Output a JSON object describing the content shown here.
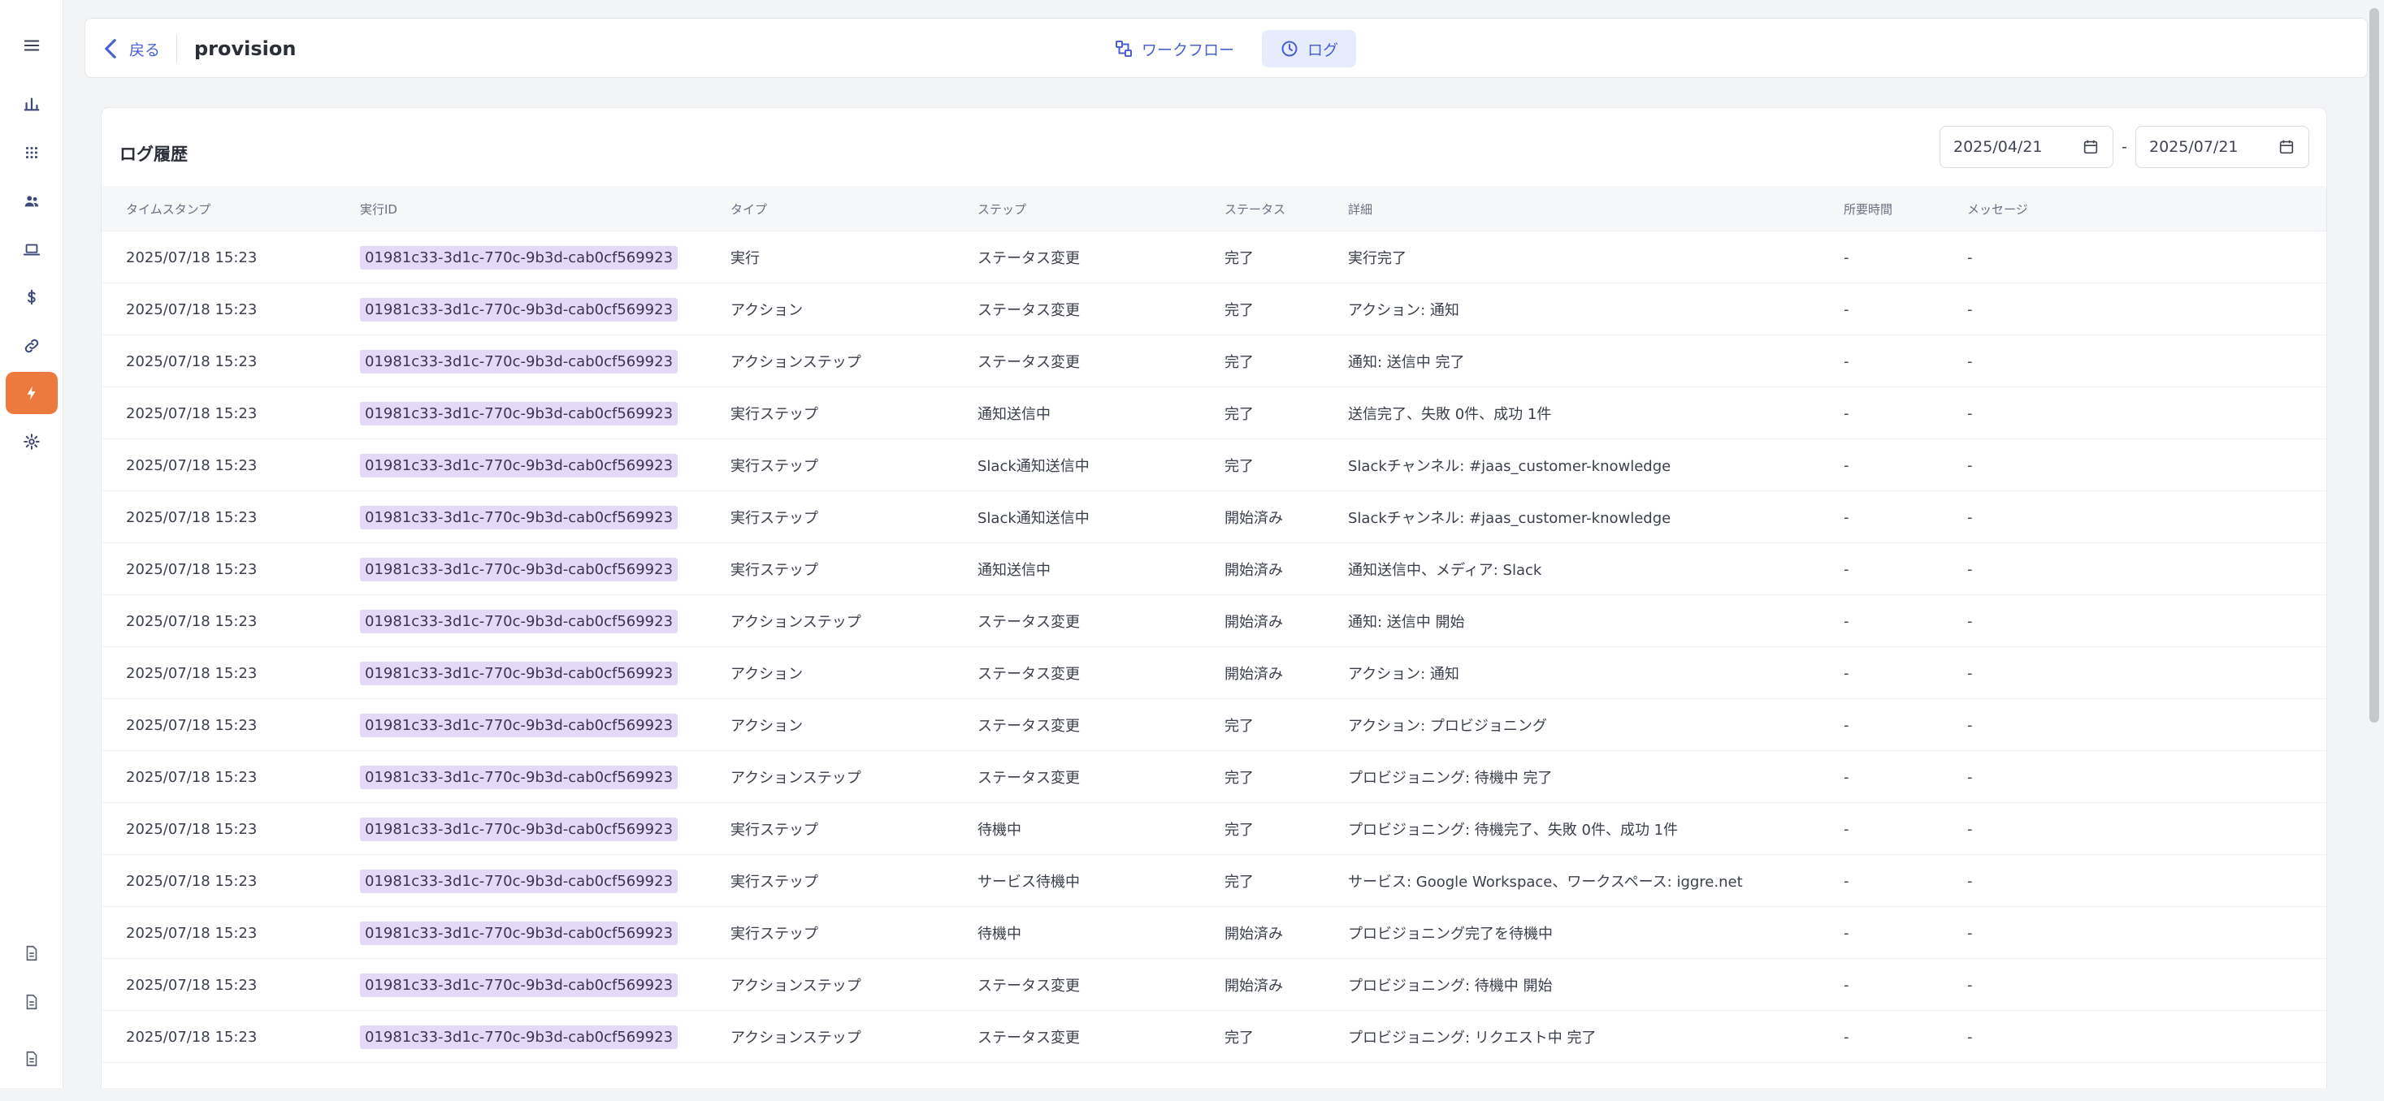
{
  "header": {
    "back_label": "戻る",
    "title": "provision",
    "tabs": [
      {
        "label": "ワークフロー",
        "icon": "workflow-icon"
      },
      {
        "label": "ログ",
        "icon": "clock-icon"
      }
    ]
  },
  "log": {
    "title": "ログ履歴",
    "date_from": "2025/04/21",
    "date_separator": "-",
    "date_to": "2025/07/21",
    "columns": [
      "タイムスタンプ",
      "実行ID",
      "タイプ",
      "ステップ",
      "ステータス",
      "詳細",
      "所要時間",
      "メッセージ"
    ],
    "rows": [
      {
        "ts": "2025/07/18 15:23",
        "id": "01981c33-3d1c-770c-9b3d-cab0cf569923",
        "type": "実行",
        "step": "ステータス変更",
        "status": "完了",
        "detail": "実行完了",
        "dur": "-",
        "msg": "-"
      },
      {
        "ts": "2025/07/18 15:23",
        "id": "01981c33-3d1c-770c-9b3d-cab0cf569923",
        "type": "アクション",
        "step": "ステータス変更",
        "status": "完了",
        "detail": "アクション: 通知",
        "dur": "-",
        "msg": "-"
      },
      {
        "ts": "2025/07/18 15:23",
        "id": "01981c33-3d1c-770c-9b3d-cab0cf569923",
        "type": "アクションステップ",
        "step": "ステータス変更",
        "status": "完了",
        "detail": "通知: 送信中 完了",
        "dur": "-",
        "msg": "-"
      },
      {
        "ts": "2025/07/18 15:23",
        "id": "01981c33-3d1c-770c-9b3d-cab0cf569923",
        "type": "実行ステップ",
        "step": "通知送信中",
        "status": "完了",
        "detail": "送信完了、失敗 0件、成功 1件",
        "dur": "-",
        "msg": "-"
      },
      {
        "ts": "2025/07/18 15:23",
        "id": "01981c33-3d1c-770c-9b3d-cab0cf569923",
        "type": "実行ステップ",
        "step": "Slack通知送信中",
        "status": "完了",
        "detail": "Slackチャンネル: #jaas_customer-knowledge",
        "dur": "-",
        "msg": "-"
      },
      {
        "ts": "2025/07/18 15:23",
        "id": "01981c33-3d1c-770c-9b3d-cab0cf569923",
        "type": "実行ステップ",
        "step": "Slack通知送信中",
        "status": "開始済み",
        "detail": "Slackチャンネル: #jaas_customer-knowledge",
        "dur": "-",
        "msg": "-"
      },
      {
        "ts": "2025/07/18 15:23",
        "id": "01981c33-3d1c-770c-9b3d-cab0cf569923",
        "type": "実行ステップ",
        "step": "通知送信中",
        "status": "開始済み",
        "detail": "通知送信中、メディア: Slack",
        "dur": "-",
        "msg": "-"
      },
      {
        "ts": "2025/07/18 15:23",
        "id": "01981c33-3d1c-770c-9b3d-cab0cf569923",
        "type": "アクションステップ",
        "step": "ステータス変更",
        "status": "開始済み",
        "detail": "通知: 送信中 開始",
        "dur": "-",
        "msg": "-"
      },
      {
        "ts": "2025/07/18 15:23",
        "id": "01981c33-3d1c-770c-9b3d-cab0cf569923",
        "type": "アクション",
        "step": "ステータス変更",
        "status": "開始済み",
        "detail": "アクション: 通知",
        "dur": "-",
        "msg": "-"
      },
      {
        "ts": "2025/07/18 15:23",
        "id": "01981c33-3d1c-770c-9b3d-cab0cf569923",
        "type": "アクション",
        "step": "ステータス変更",
        "status": "完了",
        "detail": "アクション: プロビジョニング",
        "dur": "-",
        "msg": "-"
      },
      {
        "ts": "2025/07/18 15:23",
        "id": "01981c33-3d1c-770c-9b3d-cab0cf569923",
        "type": "アクションステップ",
        "step": "ステータス変更",
        "status": "完了",
        "detail": "プロビジョニング: 待機中 完了",
        "dur": "-",
        "msg": "-"
      },
      {
        "ts": "2025/07/18 15:23",
        "id": "01981c33-3d1c-770c-9b3d-cab0cf569923",
        "type": "実行ステップ",
        "step": "待機中",
        "status": "完了",
        "detail": "プロビジョニング: 待機完了、失敗 0件、成功 1件",
        "dur": "-",
        "msg": "-"
      },
      {
        "ts": "2025/07/18 15:23",
        "id": "01981c33-3d1c-770c-9b3d-cab0cf569923",
        "type": "実行ステップ",
        "step": "サービス待機中",
        "status": "完了",
        "detail": "サービス: Google Workspace、ワークスペース: iggre.net",
        "dur": "-",
        "msg": "-"
      },
      {
        "ts": "2025/07/18 15:23",
        "id": "01981c33-3d1c-770c-9b3d-cab0cf569923",
        "type": "実行ステップ",
        "step": "待機中",
        "status": "開始済み",
        "detail": "プロビジョニング完了を待機中",
        "dur": "-",
        "msg": "-"
      },
      {
        "ts": "2025/07/18 15:23",
        "id": "01981c33-3d1c-770c-9b3d-cab0cf569923",
        "type": "アクションステップ",
        "step": "ステータス変更",
        "status": "開始済み",
        "detail": "プロビジョニング: 待機中 開始",
        "dur": "-",
        "msg": "-"
      },
      {
        "ts": "2025/07/18 15:23",
        "id": "01981c33-3d1c-770c-9b3d-cab0cf569923",
        "type": "アクションステップ",
        "step": "ステータス変更",
        "status": "完了",
        "detail": "プロビジョニング: リクエスト中 完了",
        "dur": "-",
        "msg": "-"
      }
    ]
  },
  "colors": {
    "accent": "#4a5fd0",
    "active_nav": "#ec7a3f",
    "runid_bg": "#e4d9f6"
  }
}
